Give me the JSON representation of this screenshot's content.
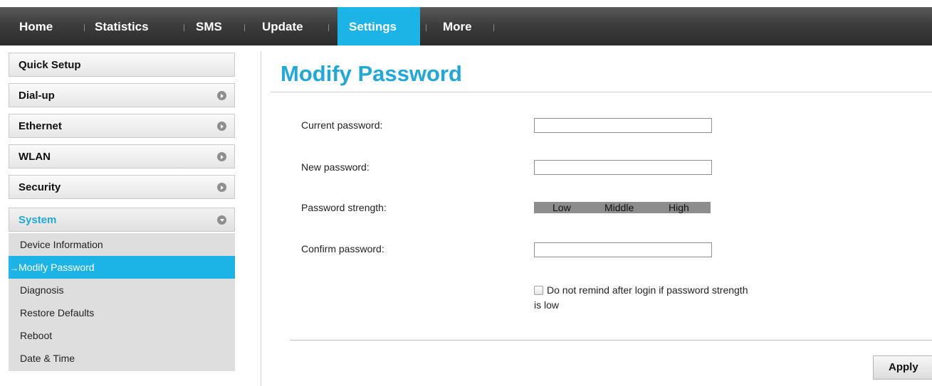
{
  "nav": {
    "items": [
      {
        "label": "Home"
      },
      {
        "label": "Statistics"
      },
      {
        "label": "SMS"
      },
      {
        "label": "Update"
      },
      {
        "label": "Settings",
        "active": true
      },
      {
        "label": "More"
      }
    ]
  },
  "sidebar": {
    "sections": [
      {
        "label": "Quick Setup",
        "icon": "none"
      },
      {
        "label": "Dial-up",
        "icon": "chevron-right-icon"
      },
      {
        "label": "Ethernet",
        "icon": "chevron-right-icon"
      },
      {
        "label": "WLAN",
        "icon": "chevron-right-icon"
      },
      {
        "label": "Security",
        "icon": "chevron-right-icon"
      },
      {
        "label": "System",
        "icon": "chevron-down-icon",
        "expanded": true
      }
    ],
    "system_items": [
      {
        "label": "Device Information"
      },
      {
        "label": "Modify Password",
        "active": true,
        "marker": "→"
      },
      {
        "label": "Diagnosis"
      },
      {
        "label": "Restore Defaults"
      },
      {
        "label": "Reboot"
      },
      {
        "label": "Date & Time"
      }
    ]
  },
  "main": {
    "title": "Modify Password",
    "form": {
      "current_password_label": "Current password:",
      "current_password_value": "",
      "new_password_label": "New password:",
      "new_password_value": "",
      "strength_label": "Password strength:",
      "strength_levels": [
        "Low",
        "Middle",
        "High"
      ],
      "confirm_password_label": "Confirm password:",
      "confirm_password_value": "",
      "remind_checkbox_line1": "Do not remind after login if password strength",
      "remind_checkbox_line2": "is low",
      "remind_checked": false
    },
    "apply_label": "Apply"
  },
  "colors": {
    "accent": "#1cb4e6",
    "title": "#1fa8d8",
    "nav_bg": "#3d3d3d",
    "strength_bar": "#8c8c8c"
  }
}
